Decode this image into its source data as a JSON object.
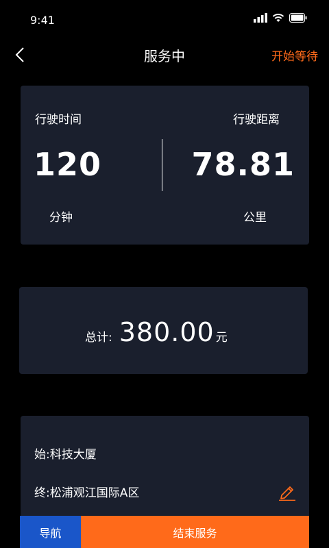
{
  "status_bar": {
    "time": "9:41"
  },
  "header": {
    "title": "服务中",
    "right_action": "开始等待"
  },
  "stats": {
    "left": {
      "label": "行驶时间",
      "value": "120",
      "unit": "分钟"
    },
    "right": {
      "label": "行驶距离",
      "value": "78.81",
      "unit": "公里"
    }
  },
  "total": {
    "label": "总计:",
    "amount": "380.00",
    "unit": "元"
  },
  "route": {
    "start": "始:科技大厦",
    "end": "终:松浦观江国际A区"
  },
  "buttons": {
    "navigate": "导航",
    "end_service": "结束服务"
  },
  "colors": {
    "accent": "#ff6a1a",
    "nav_blue": "#1a56c9",
    "card_bg": "#1a1f2d"
  }
}
